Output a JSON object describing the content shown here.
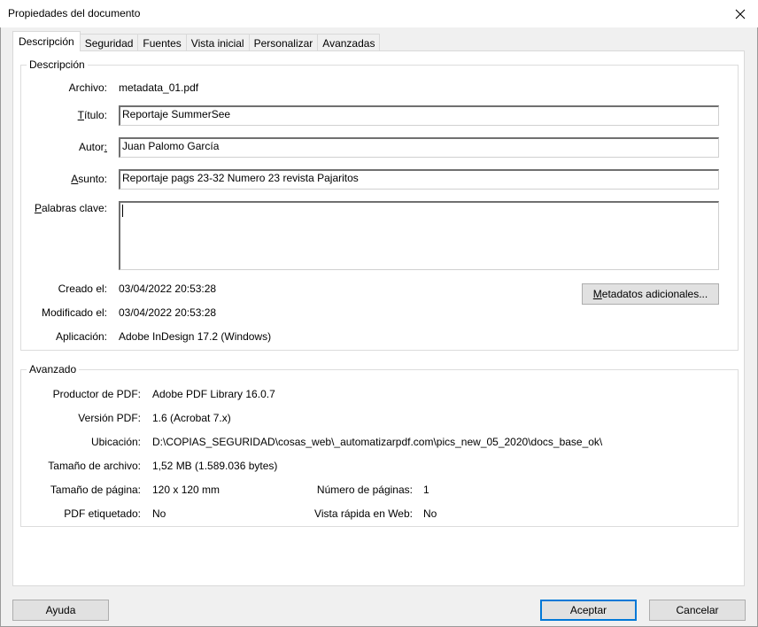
{
  "window": {
    "title": "Propiedades del documento"
  },
  "tabs": [
    {
      "label": "Descripción",
      "active": true
    },
    {
      "label": "Seguridad"
    },
    {
      "label": "Fuentes"
    },
    {
      "label": "Vista inicial"
    },
    {
      "label": "Personalizar"
    },
    {
      "label": "Avanzadas"
    }
  ],
  "description": {
    "legend": "Descripción",
    "file_label": "Archivo:",
    "file_value": "metadata_01.pdf",
    "title_label_pre": "",
    "title_label_u": "T",
    "title_label_post": "ítulo:",
    "title_value": "Reportaje SummerSee",
    "author_label_pre": "Autor",
    "author_label_u": ":",
    "author_label_post": "",
    "author_value": "Juan Palomo García",
    "subject_label_pre": "",
    "subject_label_u": "A",
    "subject_label_post": "sunto:",
    "subject_value": "Reportaje pags 23-32 Numero 23 revista Pajaritos",
    "keywords_label_pre": "",
    "keywords_label_u": "P",
    "keywords_label_post": "alabras clave:",
    "keywords_value": "",
    "created_label": "Creado el:",
    "created_value": "03/04/2022 20:53:28",
    "modified_label": "Modificado el:",
    "modified_value": "03/04/2022 20:53:28",
    "application_label": "Aplicación:",
    "application_value": "Adobe InDesign 17.2 (Windows)",
    "more_metadata_pre": "",
    "more_metadata_u": "M",
    "more_metadata_post": "etadatos adicionales..."
  },
  "advanced": {
    "legend": "Avanzado",
    "producer_label": "Productor de PDF:",
    "producer_value": "Adobe PDF Library 16.0.7",
    "version_label": "Versión PDF:",
    "version_value": "1.6 (Acrobat 7.x)",
    "location_label": "Ubicación:",
    "location_value": "D:\\COPIAS_SEGURIDAD\\cosas_web\\_automatizarpdf.com\\pics_new_05_2020\\docs_base_ok\\",
    "filesize_label": "Tamaño de archivo:",
    "filesize_value": "1,52 MB (1.589.036 bytes)",
    "pagesize_label": "Tamaño de página:",
    "pagesize_value": "120 x 120 mm",
    "pagecount_label": "Número de páginas:",
    "pagecount_value": "1",
    "tagged_label": "PDF etiquetado:",
    "tagged_value": "No",
    "fastweb_label": "Vista rápida en Web:",
    "fastweb_value": "No"
  },
  "footer": {
    "help_label": "Ayuda",
    "ok_label": "Aceptar",
    "cancel_label": "Cancelar"
  },
  "colors": {
    "accent": "#0078d7",
    "panel": "#ffffff",
    "dialog": "#f0f0f0"
  },
  "icons": {
    "close": "close-icon"
  }
}
